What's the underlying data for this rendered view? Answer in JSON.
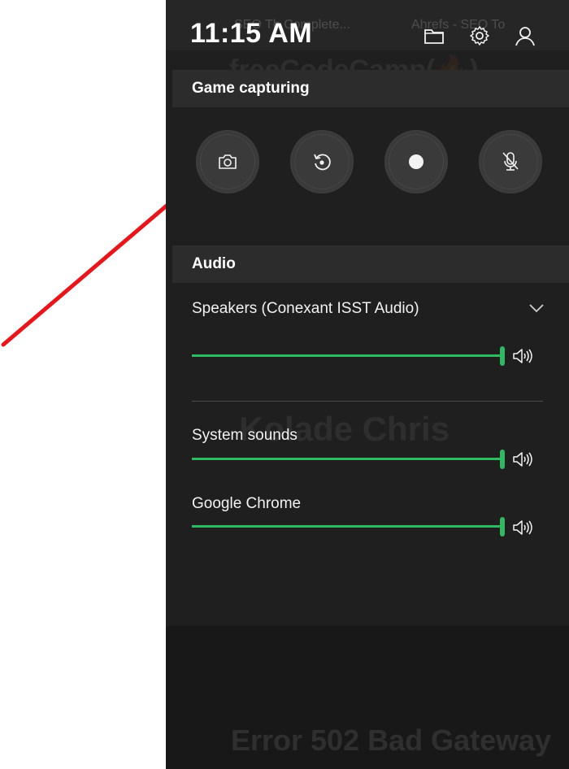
{
  "background": {
    "tabs": [
      "SEO Th   Complete...",
      "Ahrefs - SEO To"
    ],
    "headings": [
      "freeCodeCamp(🔥)",
      "Kolade Chris",
      "Error 502 Bad Gateway"
    ]
  },
  "topbar": {
    "time": "11:15 AM",
    "icons": [
      "folder-icon",
      "gear-icon",
      "user-icon"
    ]
  },
  "game_capturing": {
    "title": "Game capturing",
    "buttons": [
      "camera-icon",
      "replay-icon",
      "record-icon",
      "mic-off-icon"
    ]
  },
  "audio": {
    "title": "Audio",
    "device": {
      "name": "Speakers (Conexant ISST Audio)",
      "level": 1.0
    },
    "apps": [
      {
        "name": "System sounds",
        "level": 1.0
      },
      {
        "name": "Google Chrome",
        "level": 1.0
      }
    ]
  },
  "colors": {
    "accent": "#2fb961",
    "panel": "#1f1f1f",
    "header": "#2c2c2c",
    "arrow": "#e8151b"
  }
}
